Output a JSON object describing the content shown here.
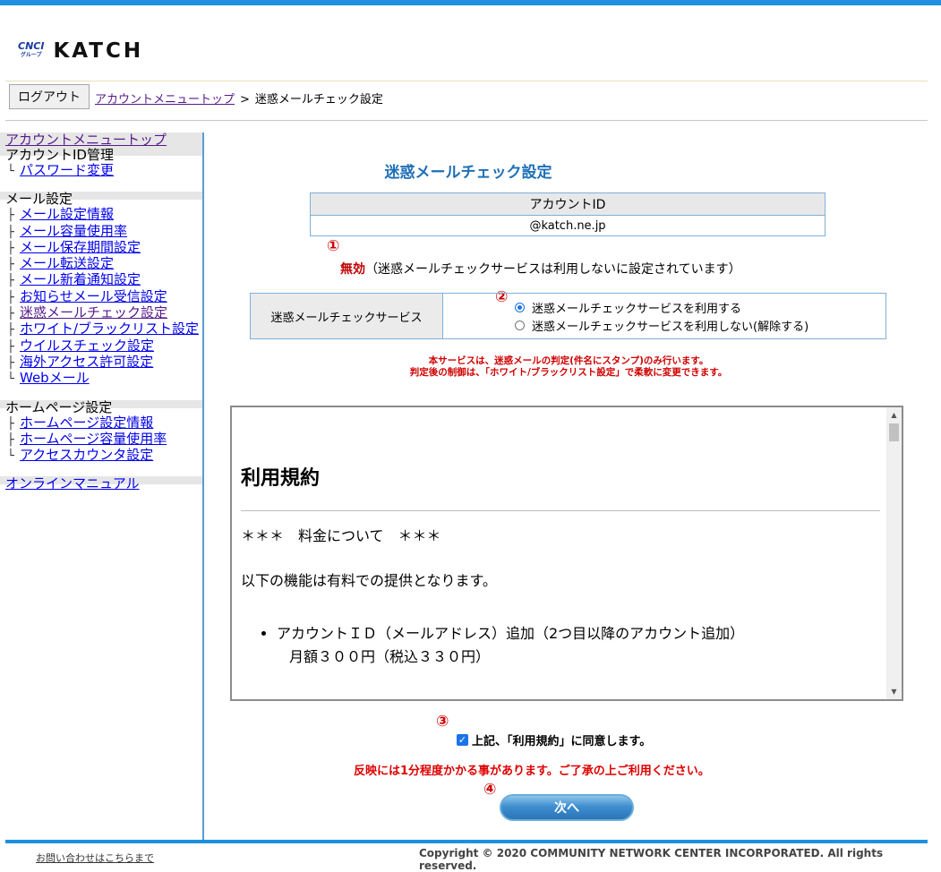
{
  "logo": {
    "brand_small": "CNCI",
    "brand_small_sub": "グループ",
    "brand": "KATCH"
  },
  "header": {
    "logout_label": "ログアウト",
    "breadcrumb_link": "アカウントメニュートップ",
    "breadcrumb_sep": ">",
    "breadcrumb_current": "迷惑メールチェック設定"
  },
  "sidebar": {
    "top_link": "アカウントメニュートップ",
    "groups": [
      {
        "title": "アカウントID管理",
        "items": [
          "パスワード変更"
        ]
      },
      {
        "title": "メール設定",
        "items": [
          "メール設定情報",
          "メール容量使用率",
          "メール保存期間設定",
          "メール転送設定",
          "メール新着通知設定",
          "お知らせメール受信設定",
          "迷惑メールチェック設定",
          "ホワイト/ブラックリスト設定",
          "ウイルスチェック設定",
          "海外アクセス許可設定",
          "Webメール"
        ]
      },
      {
        "title": "ホームページ設定",
        "items": [
          "ホームページ設定情報",
          "ホームページ容量使用率",
          "アクセスカウンタ設定"
        ]
      }
    ],
    "manual_link": "オンラインマニュアル"
  },
  "main": {
    "title": "迷惑メールチェック設定",
    "account_header": "アカウントID",
    "account_value": "@katch.ne.jp",
    "markers": [
      "①",
      "②",
      "③",
      "④"
    ],
    "status_value": "無効",
    "status_note": "（迷惑メールチェックサービスは利用しないに設定されています）",
    "service_label": "迷惑メールチェックサービス",
    "option_use": "迷惑メールチェックサービスを利用する",
    "option_not_use": "迷惑メールチェックサービスを利用しない(解除する)",
    "notice_line1": "本サービスは、迷惑メールの判定(件名にスタンプ)のみ行います。",
    "notice_line2": "判定後の制御は、「ホワイト/ブラックリスト設定」で柔軟に変更できます。",
    "terms": {
      "heading": "利用規約",
      "section": "＊＊＊　料金について　＊＊＊",
      "intro": "以下の機能は有料での提供となります。",
      "item1": "アカウントＩＤ（メールアドレス）追加（2つ目以降のアカウント追加）",
      "item1_price": "月額３００円（税込３３０円）"
    },
    "agree_label": "上記、「利用規約」に同意します。",
    "warning": "反映には1分程度かかる事があります。ご了承の上ご利用ください。",
    "next_label": "次へ"
  },
  "footer": {
    "contact": "お問い合わせはこちらまで",
    "copyright": "Copyright © 2020 COMMUNITY NETWORK CENTER INCORPORATED. All rights reserved."
  }
}
